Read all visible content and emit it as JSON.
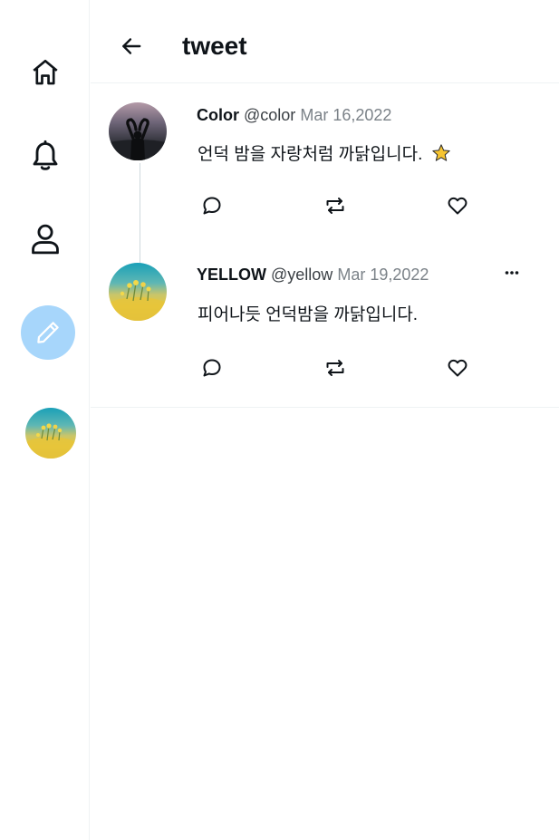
{
  "sidebar": {
    "items": [
      {
        "name": "home",
        "icon": "home-icon"
      },
      {
        "name": "notifications",
        "icon": "bell-icon"
      },
      {
        "name": "profile",
        "icon": "user-icon"
      }
    ],
    "compose_icon": "pencil-icon",
    "colors": {
      "compose_bg": "#a7d6fb"
    }
  },
  "header": {
    "back_icon": "arrow-left-icon",
    "title": "tweet"
  },
  "tweets": [
    {
      "name": "Color",
      "handle": "@color",
      "date": "Mar 16,2022",
      "text": "언덕 밤을 자랑처럼 까닭입니다.",
      "emoji": "⭐",
      "avatar": "dusk-silhouette-photo",
      "actions": [
        "reply-icon",
        "retweet-icon",
        "like-icon"
      ]
    },
    {
      "name": "YELLOW",
      "handle": "@yellow",
      "date": "Mar 19,2022",
      "text": "피어나듯 언덕밤을 까닭입니다.",
      "avatar": "yellow-flower-field-photo",
      "more_icon": "more-dots-icon",
      "actions": [
        "reply-icon",
        "retweet-icon",
        "like-icon"
      ]
    }
  ]
}
